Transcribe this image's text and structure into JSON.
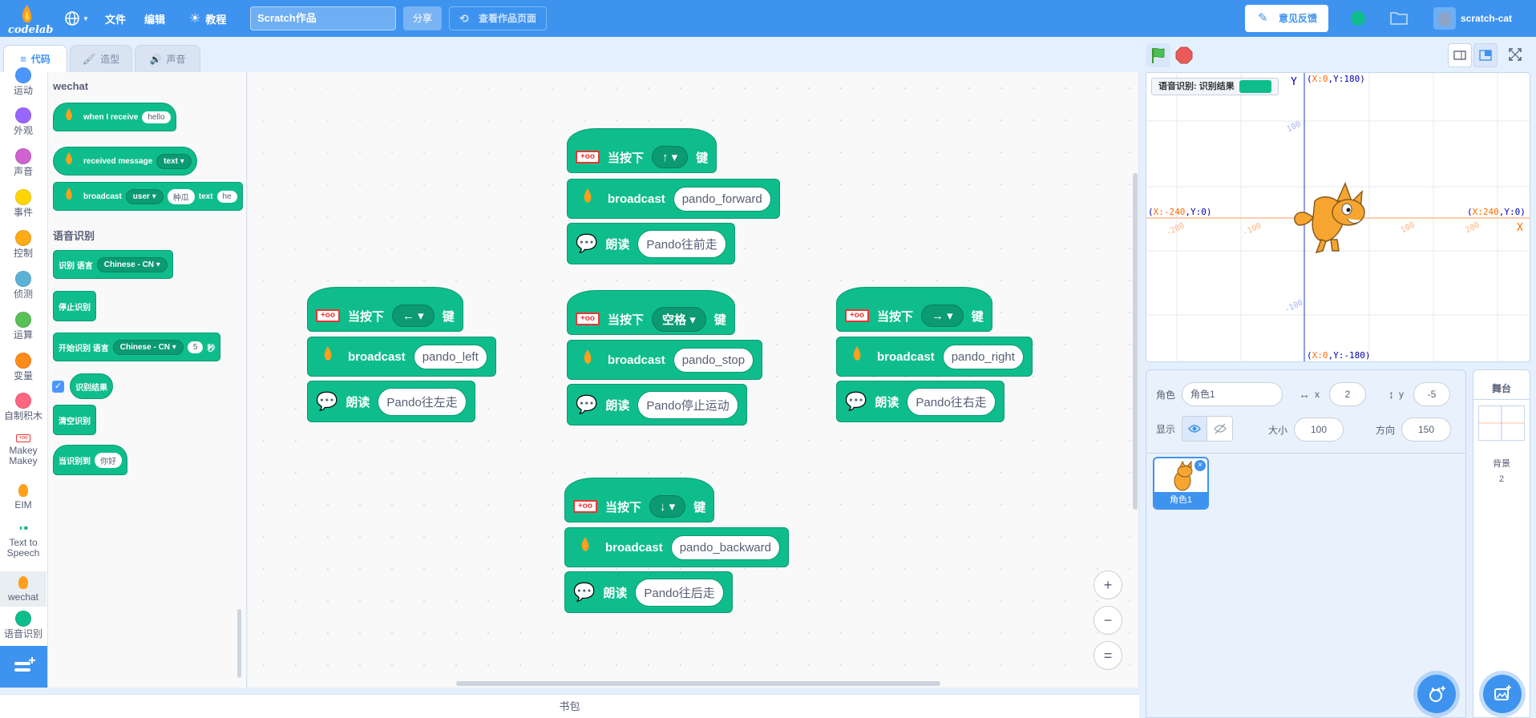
{
  "menubar": {
    "logo_text": "codelab",
    "file": "文件",
    "edit": "编辑",
    "tutorial": "教程",
    "project_title": "Scratch作品",
    "share": "分享",
    "see_project": "查看作品页面",
    "feedback": "意见反馈",
    "username": "scratch-cat"
  },
  "tabs": {
    "code": "代码",
    "costumes": "造型",
    "sounds": "声音"
  },
  "categories": [
    {
      "label": "运动",
      "color": "#4c97ff"
    },
    {
      "label": "外观",
      "color": "#9966ff"
    },
    {
      "label": "声音",
      "color": "#cf63cf"
    },
    {
      "label": "事件",
      "color": "#ffd500"
    },
    {
      "label": "控制",
      "color": "#ffab19"
    },
    {
      "label": "侦测",
      "color": "#5cb1d6"
    },
    {
      "label": "运算",
      "color": "#59c059"
    },
    {
      "label": "变量",
      "color": "#ff8c1a"
    },
    {
      "label": "自制积木",
      "color": "#ff6680"
    },
    {
      "label": "Makey Makey"
    },
    {
      "label": "EIM"
    },
    {
      "label": "Text to Speech"
    },
    {
      "label": "wechat"
    },
    {
      "label": "语音识别",
      "color": "#0fbd8c"
    }
  ],
  "flyout": {
    "wechat_header": "wechat",
    "when_receive": "when I receive",
    "when_receive_arg": "hello",
    "received_message": "received message",
    "received_message_arg": "text",
    "broadcast": "broadcast",
    "broadcast_user": "user",
    "broadcast_mid": "种瓜",
    "broadcast_text": "text",
    "broadcast_tail": "he",
    "speech_header": "语音识别",
    "recognize_lang": "识别 语言",
    "lang_value": "Chinese - CN",
    "stop": "停止识别",
    "start": "开始识别 语言",
    "start_lang": "Chinese - CN",
    "start_secs": "5",
    "start_unit": "秒",
    "result": "识别结果",
    "clear": "清空识别",
    "when_heard": "当识别到",
    "when_heard_arg": "你好"
  },
  "scripts": {
    "when_key": "当按下",
    "key_suffix": "键",
    "broadcast": "broadcast",
    "speak": "朗读",
    "up": {
      "key": "↑",
      "msg": "pando_forward",
      "say": "Pando往前走"
    },
    "left": {
      "key": "←",
      "msg": "pando_left",
      "say": "Pando往左走"
    },
    "space": {
      "key": "空格",
      "msg": "pando_stop",
      "say": "Pando停止运动"
    },
    "right": {
      "key": "→",
      "msg": "pando_right",
      "say": "Pando往右走"
    },
    "down": {
      "key": "↓",
      "msg": "pando_backward",
      "say": "Pando往后走"
    }
  },
  "zoom": {
    "in": "+",
    "out": "−",
    "reset": "="
  },
  "backpack": "书包",
  "stage": {
    "monitor_label": "语音识别: 识别结果",
    "axis_y": "Y",
    "axis_x": "X",
    "top_x": "X:0",
    "top_y": "Y:180",
    "bottom_x": "X:0",
    "bottom_y": "Y:-180",
    "left_x": "X:-240",
    "left_y": "Y:0",
    "right_x": "X:240",
    "right_y": "Y:0",
    "center_label": "0)",
    "tick_m200": "-200",
    "tick_m100": "-100",
    "tick_100": "100",
    "tick_200": "200",
    "ytick_100": "100",
    "ytick_m100": "-100"
  },
  "sprite_info": {
    "sprite_label": "角色",
    "sprite_name": "角色1",
    "x_label": "x",
    "x_value": "2",
    "y_label": "y",
    "y_value": "-5",
    "show_label": "显示",
    "size_label": "大小",
    "size_value": "100",
    "direction_label": "方向",
    "direction_value": "150",
    "sprite_thumb_name": "角色1"
  },
  "stage_pane": {
    "title": "舞台",
    "backdrops_label": "背景",
    "backdrops_count": "2"
  },
  "colors": {
    "accent": "#3e93ef",
    "block": "#0fbd8c",
    "block_dark": "#0b9a72"
  }
}
